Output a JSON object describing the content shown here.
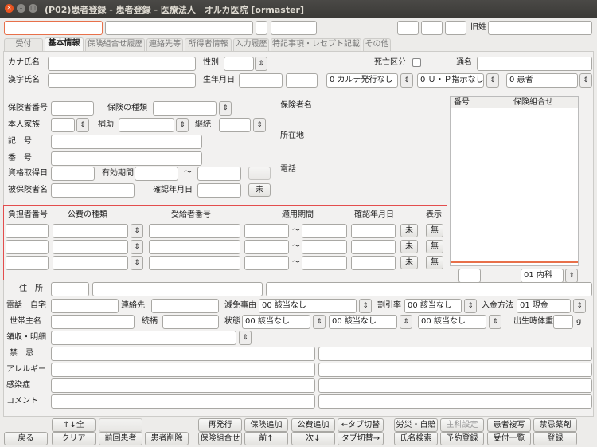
{
  "window": {
    "title": "(P02)患者登録 - 患者登録 - 医療法人　オルカ医院 [ormaster]",
    "close": "✕",
    "minimize": "–",
    "maximize": "□"
  },
  "top": {
    "kyusei_label": "旧姓"
  },
  "tabs": [
    "受付",
    "基本情報",
    "保険組合せ履歴",
    "連絡先等",
    "所得者情報",
    "入力履歴",
    "特記事項・レセプト記載",
    "その他"
  ],
  "patient": {
    "kana_label": "カナ氏名",
    "kanji_label": "漢字氏名",
    "sex_label": "性別",
    "birth_label": "生年月日",
    "death_label": "死亡区分",
    "tsumei_label": "通名",
    "karte": "0 カルテ発行なし",
    "up": "0 Ｕ・Ｐ指示なし",
    "kanja": "0 患者"
  },
  "insurance": {
    "hokensha_no": "保険者番号",
    "hoken_type": "保険の種類",
    "honnin": "本人家族",
    "hojo": "補助",
    "keizoku": "継続",
    "kigo": "記　号",
    "bango": "番　号",
    "shutoku": "資格取得日",
    "yuko": "有効期間",
    "tilde": "〜",
    "hihokensha": "被保険者名",
    "kakunin": "確認年月日",
    "mi": "未",
    "hokensha_mei": "保険者名",
    "shozaichi": "所在地",
    "denwa": "電話"
  },
  "combo": {
    "bango": "番号",
    "kumiawase": "保険組合せ",
    "naika": "01 内科"
  },
  "kohi": {
    "headers": [
      "負担者番号",
      "公費の種類",
      "受給者番号",
      "適用期間",
      "確認年月日",
      "表示"
    ],
    "rows": [
      {
        "tilde": "〜",
        "mi": "未",
        "mu": "無"
      },
      {
        "tilde": "〜",
        "mi": "未",
        "mu": "無"
      },
      {
        "tilde": "〜",
        "mi": "未",
        "mu": "無"
      }
    ]
  },
  "address": {
    "jusho": "住　所",
    "tel_label": "電話　自宅",
    "renrakusaki": "連絡先",
    "genmen_label": "減免事由",
    "genmen": "00 該当なし",
    "waribiki_label": "割引率",
    "waribiki": "00 該当なし",
    "nyukin_label": "入金方法",
    "nyukin": "01 現金",
    "setai": "世帯主名",
    "zokugara": "続柄",
    "jotai": "状態",
    "jotai1": "00 該当なし",
    "jotai2": "00 該当なし",
    "jotai3": "00 該当なし",
    "taiju": "出生時体重",
    "g": "g",
    "ryoshu": "領収・明細",
    "kinki": "禁　忌",
    "allergy": "アレルギー",
    "kansen": "感染症",
    "comment": "コメント"
  },
  "footer": {
    "row1": [
      "↑↓全",
      "",
      "再発行",
      "保険追加",
      "公費追加",
      "←タブ切替",
      "労災・自賠",
      "主科設定",
      "患者複写",
      "禁忌薬剤"
    ],
    "row2": [
      "戻る",
      "クリア",
      "前回患者",
      "患者削除",
      "保険組合せ",
      "前↑",
      "次↓",
      "タブ切替→",
      "氏名検索",
      "予約登録",
      "受付一覧",
      "登録"
    ]
  },
  "accent": "#e8704a"
}
